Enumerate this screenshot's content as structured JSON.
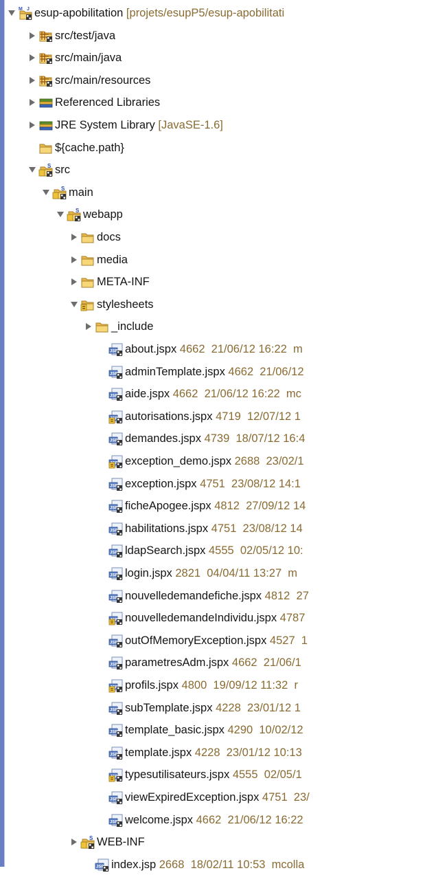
{
  "tree": [
    {
      "label": "esup-apobilitation",
      "decor": " [projets/esupP5/esup-apobilitati",
      "icon": "project-icon",
      "expanded": true,
      "depth": 0
    },
    {
      "label": "src/test/java",
      "decor": "",
      "icon": "source-folder-icon",
      "expanded": false,
      "depth": 1
    },
    {
      "label": "src/main/java",
      "decor": "",
      "icon": "source-folder-icon",
      "expanded": false,
      "depth": 1
    },
    {
      "label": "src/main/resources",
      "decor": "",
      "icon": "source-folder-icon",
      "expanded": false,
      "depth": 1
    },
    {
      "label": "Referenced Libraries",
      "decor": "",
      "icon": "library-icon",
      "expanded": false,
      "depth": 1
    },
    {
      "label": "JRE System Library",
      "decor": " [JavaSE-1.6]",
      "icon": "library-icon",
      "expanded": false,
      "depth": 1
    },
    {
      "label": "${cache.path}",
      "decor": "",
      "icon": "folder-icon",
      "expanded": null,
      "depth": 1
    },
    {
      "label": "src",
      "decor": "",
      "icon": "svn-folder-icon",
      "expanded": true,
      "depth": 1
    },
    {
      "label": "main",
      "decor": "",
      "icon": "svn-folder-icon",
      "expanded": true,
      "depth": 2
    },
    {
      "label": "webapp",
      "decor": "",
      "icon": "svn-folder-icon",
      "expanded": true,
      "depth": 3
    },
    {
      "label": "docs",
      "decor": "",
      "icon": "folder-icon",
      "expanded": false,
      "depth": 4
    },
    {
      "label": "media",
      "decor": "",
      "icon": "folder-icon",
      "expanded": false,
      "depth": 4
    },
    {
      "label": "META-INF",
      "decor": "",
      "icon": "folder-icon",
      "expanded": false,
      "depth": 4
    },
    {
      "label": "stylesheets",
      "decor": "",
      "icon": "folder-modified-icon",
      "expanded": true,
      "depth": 4
    },
    {
      "label": "_include",
      "decor": "",
      "icon": "folder-icon",
      "expanded": false,
      "depth": 5
    },
    {
      "label": "about.jspx",
      "decor": " 4662  21/06/12 16:22  m",
      "icon": "jsp-file-icon",
      "expanded": null,
      "depth": 6
    },
    {
      "label": "adminTemplate.jspx",
      "decor": " 4662  21/06/12",
      "icon": "jsp-file-icon",
      "expanded": null,
      "depth": 6
    },
    {
      "label": "aide.jspx",
      "decor": " 4662  21/06/12 16:22  mc",
      "icon": "jsp-file-icon",
      "expanded": null,
      "depth": 6
    },
    {
      "label": "autorisations.jspx",
      "decor": " 4719  12/07/12 1",
      "icon": "jsp-file-modified-icon",
      "expanded": null,
      "depth": 6
    },
    {
      "label": "demandes.jspx",
      "decor": " 4739  18/07/12 16:4",
      "icon": "jsp-file-icon",
      "expanded": null,
      "depth": 6
    },
    {
      "label": "exception_demo.jspx",
      "decor": " 2688  23/02/1",
      "icon": "jsp-file-modified-icon",
      "expanded": null,
      "depth": 6
    },
    {
      "label": "exception.jspx",
      "decor": " 4751  23/08/12 14:1",
      "icon": "jsp-file-icon",
      "expanded": null,
      "depth": 6
    },
    {
      "label": "ficheApogee.jspx",
      "decor": " 4812  27/09/12 14",
      "icon": "jsp-file-icon",
      "expanded": null,
      "depth": 6
    },
    {
      "label": "habilitations.jspx",
      "decor": " 4751  23/08/12 14",
      "icon": "jsp-file-icon",
      "expanded": null,
      "depth": 6
    },
    {
      "label": "ldapSearch.jspx",
      "decor": " 4555  02/05/12 10:",
      "icon": "jsp-file-icon",
      "expanded": null,
      "depth": 6
    },
    {
      "label": "login.jspx",
      "decor": " 2821  04/04/11 13:27  m",
      "icon": "jsp-file-icon",
      "expanded": null,
      "depth": 6
    },
    {
      "label": "nouvelledemandefiche.jspx",
      "decor": " 4812  27",
      "icon": "jsp-file-icon",
      "expanded": null,
      "depth": 6
    },
    {
      "label": "nouvelledemandeIndividu.jspx",
      "decor": " 4787",
      "icon": "jsp-file-modified-icon",
      "expanded": null,
      "depth": 6
    },
    {
      "label": "outOfMemoryException.jspx",
      "decor": " 4527  1",
      "icon": "jsp-file-icon",
      "expanded": null,
      "depth": 6
    },
    {
      "label": "parametresAdm.jspx",
      "decor": " 4662  21/06/1",
      "icon": "jsp-file-icon",
      "expanded": null,
      "depth": 6
    },
    {
      "label": "profils.jspx",
      "decor": " 4800  19/09/12 11:32  r",
      "icon": "jsp-file-modified-icon",
      "expanded": null,
      "depth": 6
    },
    {
      "label": "subTemplate.jspx",
      "decor": " 4228  23/01/12 1",
      "icon": "jsp-file-icon",
      "expanded": null,
      "depth": 6
    },
    {
      "label": "template_basic.jspx",
      "decor": " 4290  10/02/12",
      "icon": "jsp-file-icon",
      "expanded": null,
      "depth": 6
    },
    {
      "label": "template.jspx",
      "decor": " 4228  23/01/12 10:13",
      "icon": "jsp-file-icon",
      "expanded": null,
      "depth": 6
    },
    {
      "label": "typesutilisateurs.jspx",
      "decor": " 4555  02/05/1",
      "icon": "jsp-file-modified-icon",
      "expanded": null,
      "depth": 6
    },
    {
      "label": "viewExpiredException.jspx",
      "decor": " 4751  23/",
      "icon": "jsp-file-icon",
      "expanded": null,
      "depth": 6
    },
    {
      "label": "welcome.jspx",
      "decor": " 4662  21/06/12 16:22",
      "icon": "jsp-file-icon",
      "expanded": null,
      "depth": 6
    },
    {
      "label": "WEB-INF",
      "decor": "",
      "icon": "svn-folder-icon",
      "expanded": false,
      "depth": 4
    },
    {
      "label": "index.jsp",
      "decor": " 2668  18/02/11 10:53  mcolla",
      "icon": "jsp-file-icon",
      "expanded": null,
      "depth": 5
    }
  ]
}
